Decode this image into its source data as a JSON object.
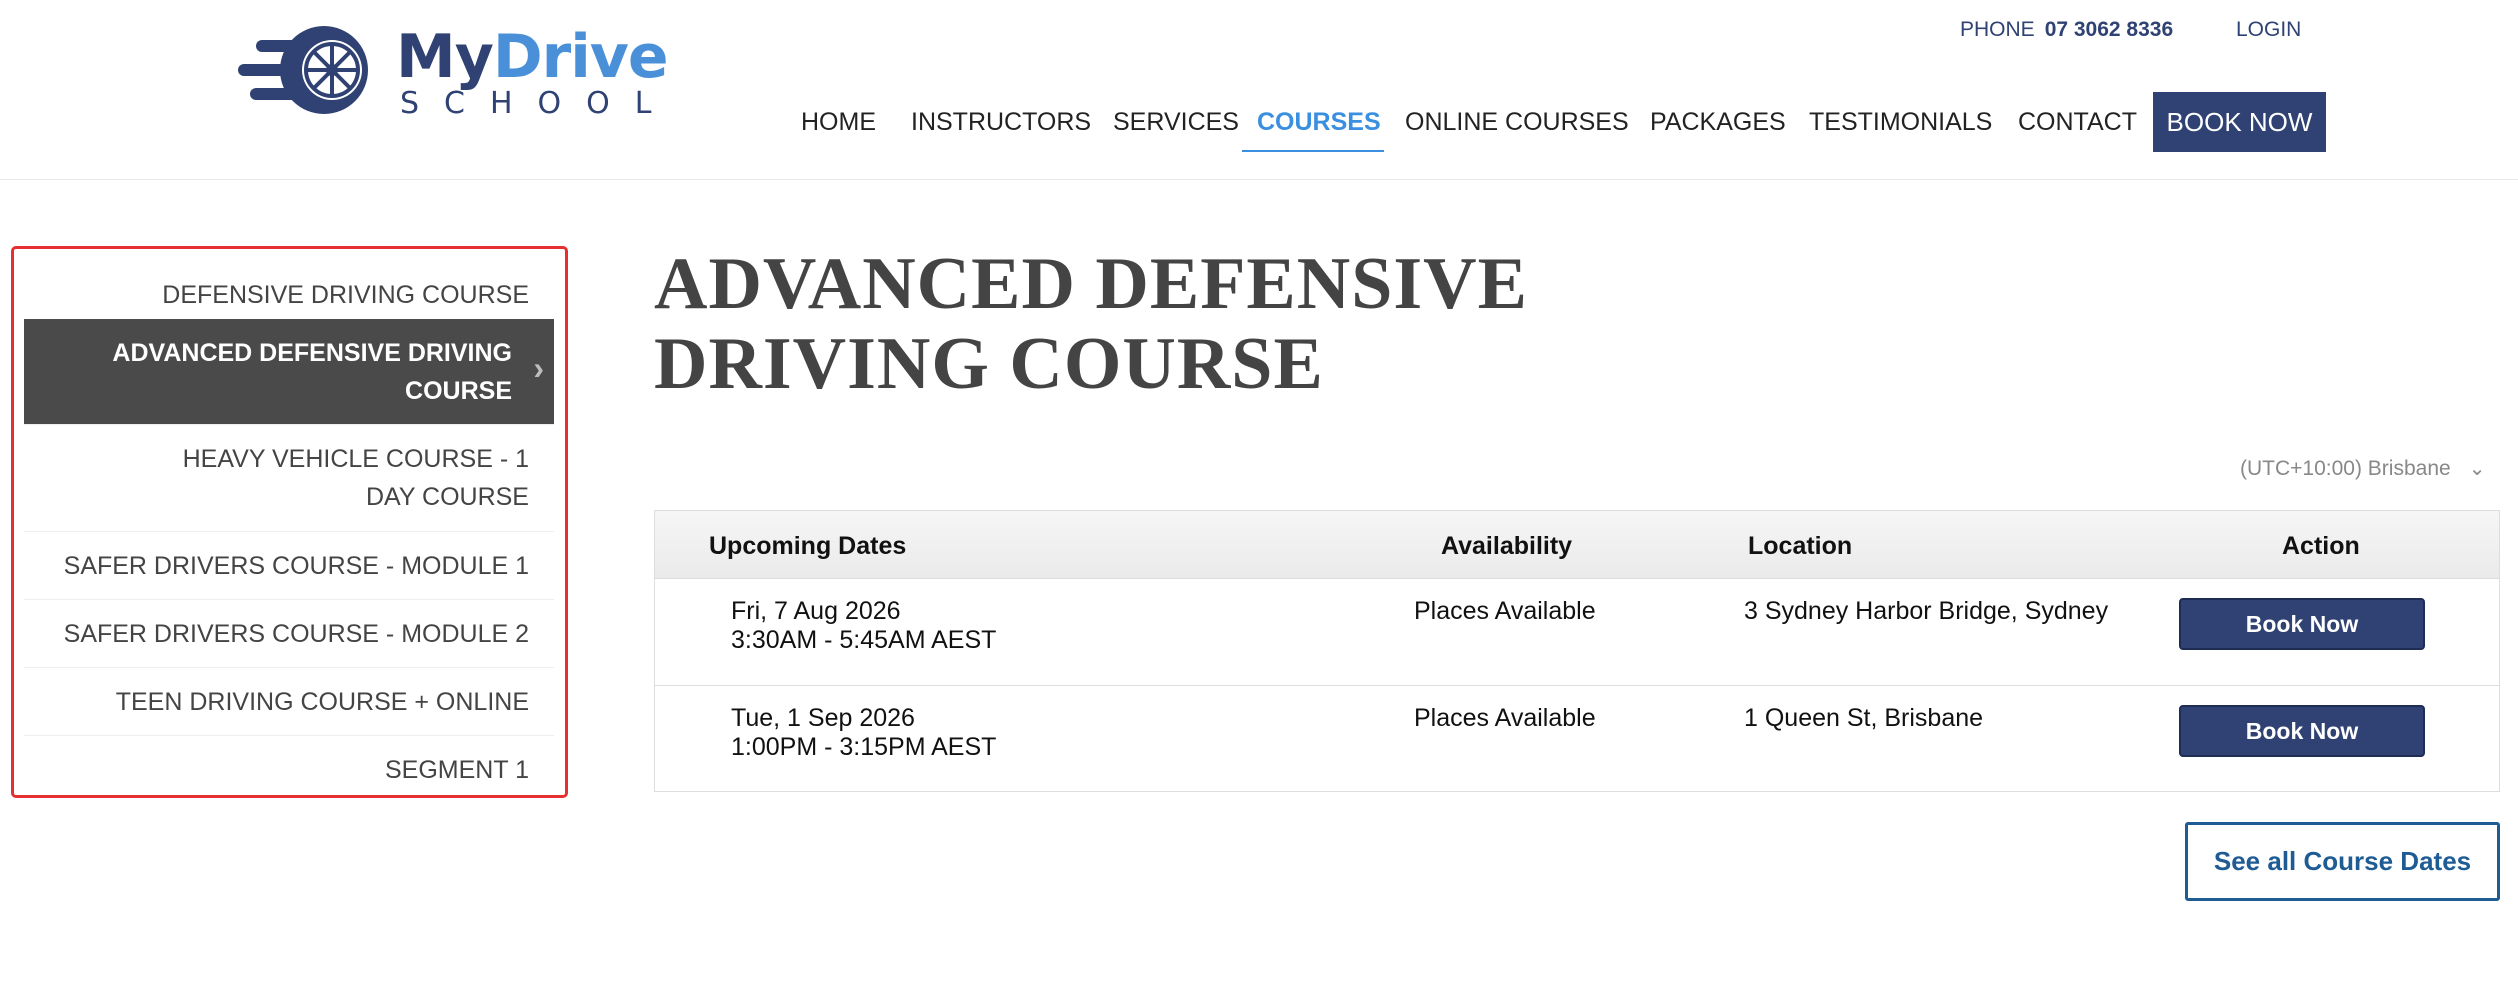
{
  "brand": {
    "name_part1": "My",
    "name_part2": "Drive",
    "subtitle": "SCHOOL",
    "primary_color": "#2f4273",
    "accent_color": "#4a90d9"
  },
  "topbar": {
    "phone_label": "PHONE",
    "phone_number": "07 3062 8336",
    "login_label": "LOGIN"
  },
  "nav": {
    "items": [
      "HOME",
      "INSTRUCTORS",
      "SERVICES",
      "COURSES",
      "ONLINE COURSES",
      "PACKAGES",
      "TESTIMONIALS",
      "CONTACT"
    ],
    "active": "COURSES",
    "book_now": "BOOK NOW"
  },
  "sidebar": {
    "items": [
      {
        "label": "DEFENSIVE DRIVING COURSE",
        "active": false
      },
      {
        "label": "ADVANCED DEFENSIVE DRIVING COURSE",
        "active": true
      },
      {
        "label": "HEAVY VEHICLE COURSE - 1 DAY COURSE",
        "active": false
      },
      {
        "label": "SAFER DRIVERS COURSE - MODULE 1",
        "active": false
      },
      {
        "label": "SAFER DRIVERS COURSE - MODULE 2",
        "active": false
      },
      {
        "label": "TEEN DRIVING COURSE + ONLINE",
        "active": false
      },
      {
        "label": "SEGMENT 1",
        "active": false
      }
    ],
    "highlight_color": "#e53030"
  },
  "main": {
    "title": "ADVANCED DEFENSIVE DRIVING COURSE",
    "timezone": "(UTC+10:00) Brisbane",
    "table": {
      "headers": [
        "Upcoming Dates",
        "Availability",
        "Location",
        "Action"
      ],
      "rows": [
        {
          "date": "Fri, 7 Aug 2026",
          "time": "3:30AM - 5:45AM AEST",
          "availability": "Places Available",
          "location": "3 Sydney Harbor Bridge, Sydney",
          "action": "Book Now"
        },
        {
          "date": "Tue, 1 Sep 2026",
          "time": "1:00PM - 3:15PM AEST",
          "availability": "Places Available",
          "location": "1 Queen St, Brisbane",
          "action": "Book Now"
        }
      ]
    },
    "see_all": "See all Course Dates"
  }
}
